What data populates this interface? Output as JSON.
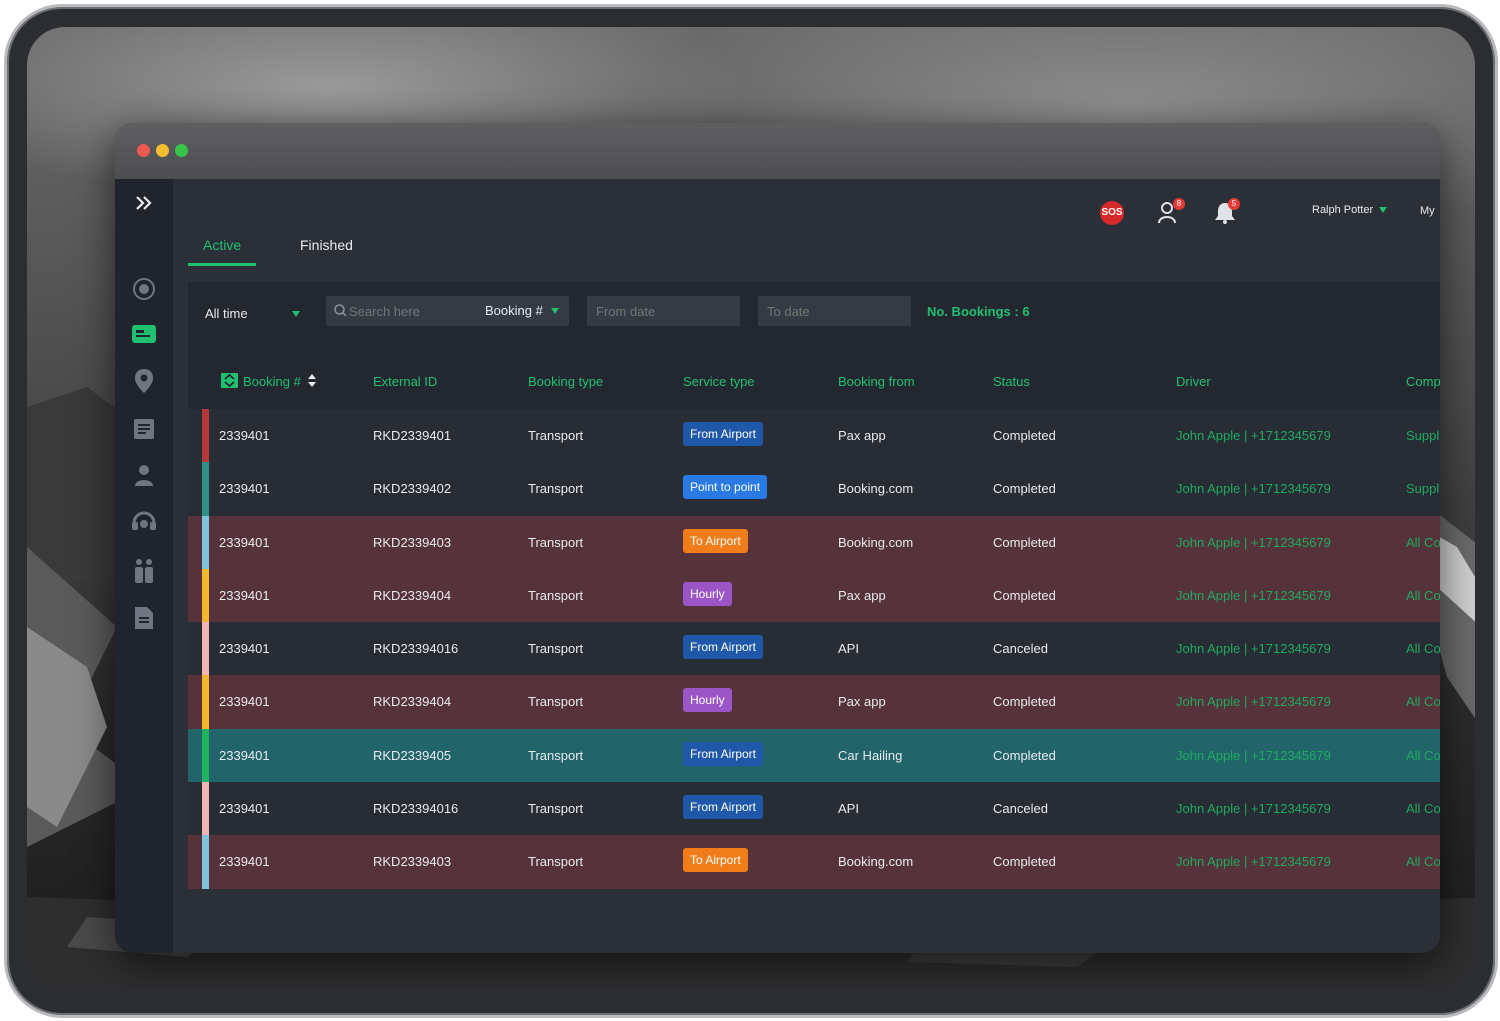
{
  "colors": {
    "accent": "#20c070",
    "driver_text": "#1faa60",
    "row_dark": "#272c35",
    "row_red": "#56323a",
    "row_teal": "#21656a",
    "pill_from_airport": "#1f58a8",
    "pill_point_to_point": "#2a7ae4",
    "pill_to_airport": "#f07d1a",
    "pill_hourly": "#9b55c7"
  },
  "topbar": {
    "sos_label": "SOS",
    "users_badge": "8",
    "bell_badge": "5",
    "user_name": "Ralph Potter",
    "my_label": "My"
  },
  "tabs": [
    {
      "label": "Active",
      "active": true
    },
    {
      "label": "Finished",
      "active": false
    }
  ],
  "filters": {
    "range": "All time",
    "search_placeholder": "Search here",
    "search_field": "Booking #",
    "from_placeholder": "From date",
    "to_placeholder": "To date",
    "count_label": "No. Bookings : 6"
  },
  "table": {
    "headers": [
      "Booking #",
      "External ID",
      "Booking type",
      "Service type",
      "Booking from",
      "Status",
      "Driver",
      "Comp"
    ],
    "rows": [
      {
        "booking": "2339401",
        "external": "RKD2339401",
        "type": "Transport",
        "service": "From Airport",
        "service_kind": "from",
        "from": "Pax app",
        "status": "Completed",
        "driver": "John Apple | +1712345679",
        "comp": "Suppl",
        "bg": "dark",
        "stripe": "#b43a3a"
      },
      {
        "booking": "2339401",
        "external": "RKD2339402",
        "type": "Transport",
        "service": "Point to point",
        "service_kind": "p2p",
        "from": "Booking.com",
        "status": "Completed",
        "driver": "John Apple | +1712345679",
        "comp": "Suppl",
        "bg": "dark",
        "stripe": "#2e8f86"
      },
      {
        "booking": "2339401",
        "external": "RKD2339403",
        "type": "Transport",
        "service": "To Airport",
        "service_kind": "to",
        "from": "Booking.com",
        "status": "Completed",
        "driver": "John Apple | +1712345679",
        "comp": "All Co",
        "bg": "red",
        "stripe": "#7cc3dd"
      },
      {
        "booking": "2339401",
        "external": "RKD2339404",
        "type": "Transport",
        "service": "Hourly",
        "service_kind": "hourly",
        "from": "Pax app",
        "status": "Completed",
        "driver": "John Apple | +1712345679",
        "comp": "All Co",
        "bg": "red",
        "stripe": "#f2b72c"
      },
      {
        "booking": "2339401",
        "external": "RKD23394016",
        "type": "Transport",
        "service": "From Airport",
        "service_kind": "from",
        "from": "API",
        "status": "Canceled",
        "driver": "John Apple | +1712345679",
        "comp": "All Co",
        "bg": "dark",
        "stripe": "#f2b3b3"
      },
      {
        "booking": "2339401",
        "external": "RKD2339404",
        "type": "Transport",
        "service": "Hourly",
        "service_kind": "hourly",
        "from": "Pax app",
        "status": "Completed",
        "driver": "John Apple | +1712345679",
        "comp": "All Co",
        "bg": "red",
        "stripe": "#f2b72c"
      },
      {
        "booking": "2339401",
        "external": "RKD2339405",
        "type": "Transport",
        "service": "From Airport",
        "service_kind": "from",
        "from": "Car Hailing",
        "status": "Completed",
        "driver": "John Apple | +1712345679",
        "comp": "All Co",
        "bg": "teal",
        "stripe": "#1eb35e"
      },
      {
        "booking": "2339401",
        "external": "RKD23394016",
        "type": "Transport",
        "service": "From Airport",
        "service_kind": "from",
        "from": "API",
        "status": "Canceled",
        "driver": "John Apple | +1712345679",
        "comp": "All Co",
        "bg": "dark",
        "stripe": "#f2b3b3"
      },
      {
        "booking": "2339401",
        "external": "RKD2339403",
        "type": "Transport",
        "service": "To Airport",
        "service_kind": "to",
        "from": "Booking.com",
        "status": "Completed",
        "driver": "John Apple | +1712345679",
        "comp": "All Co",
        "bg": "red",
        "stripe": "#7cc3dd"
      }
    ]
  }
}
